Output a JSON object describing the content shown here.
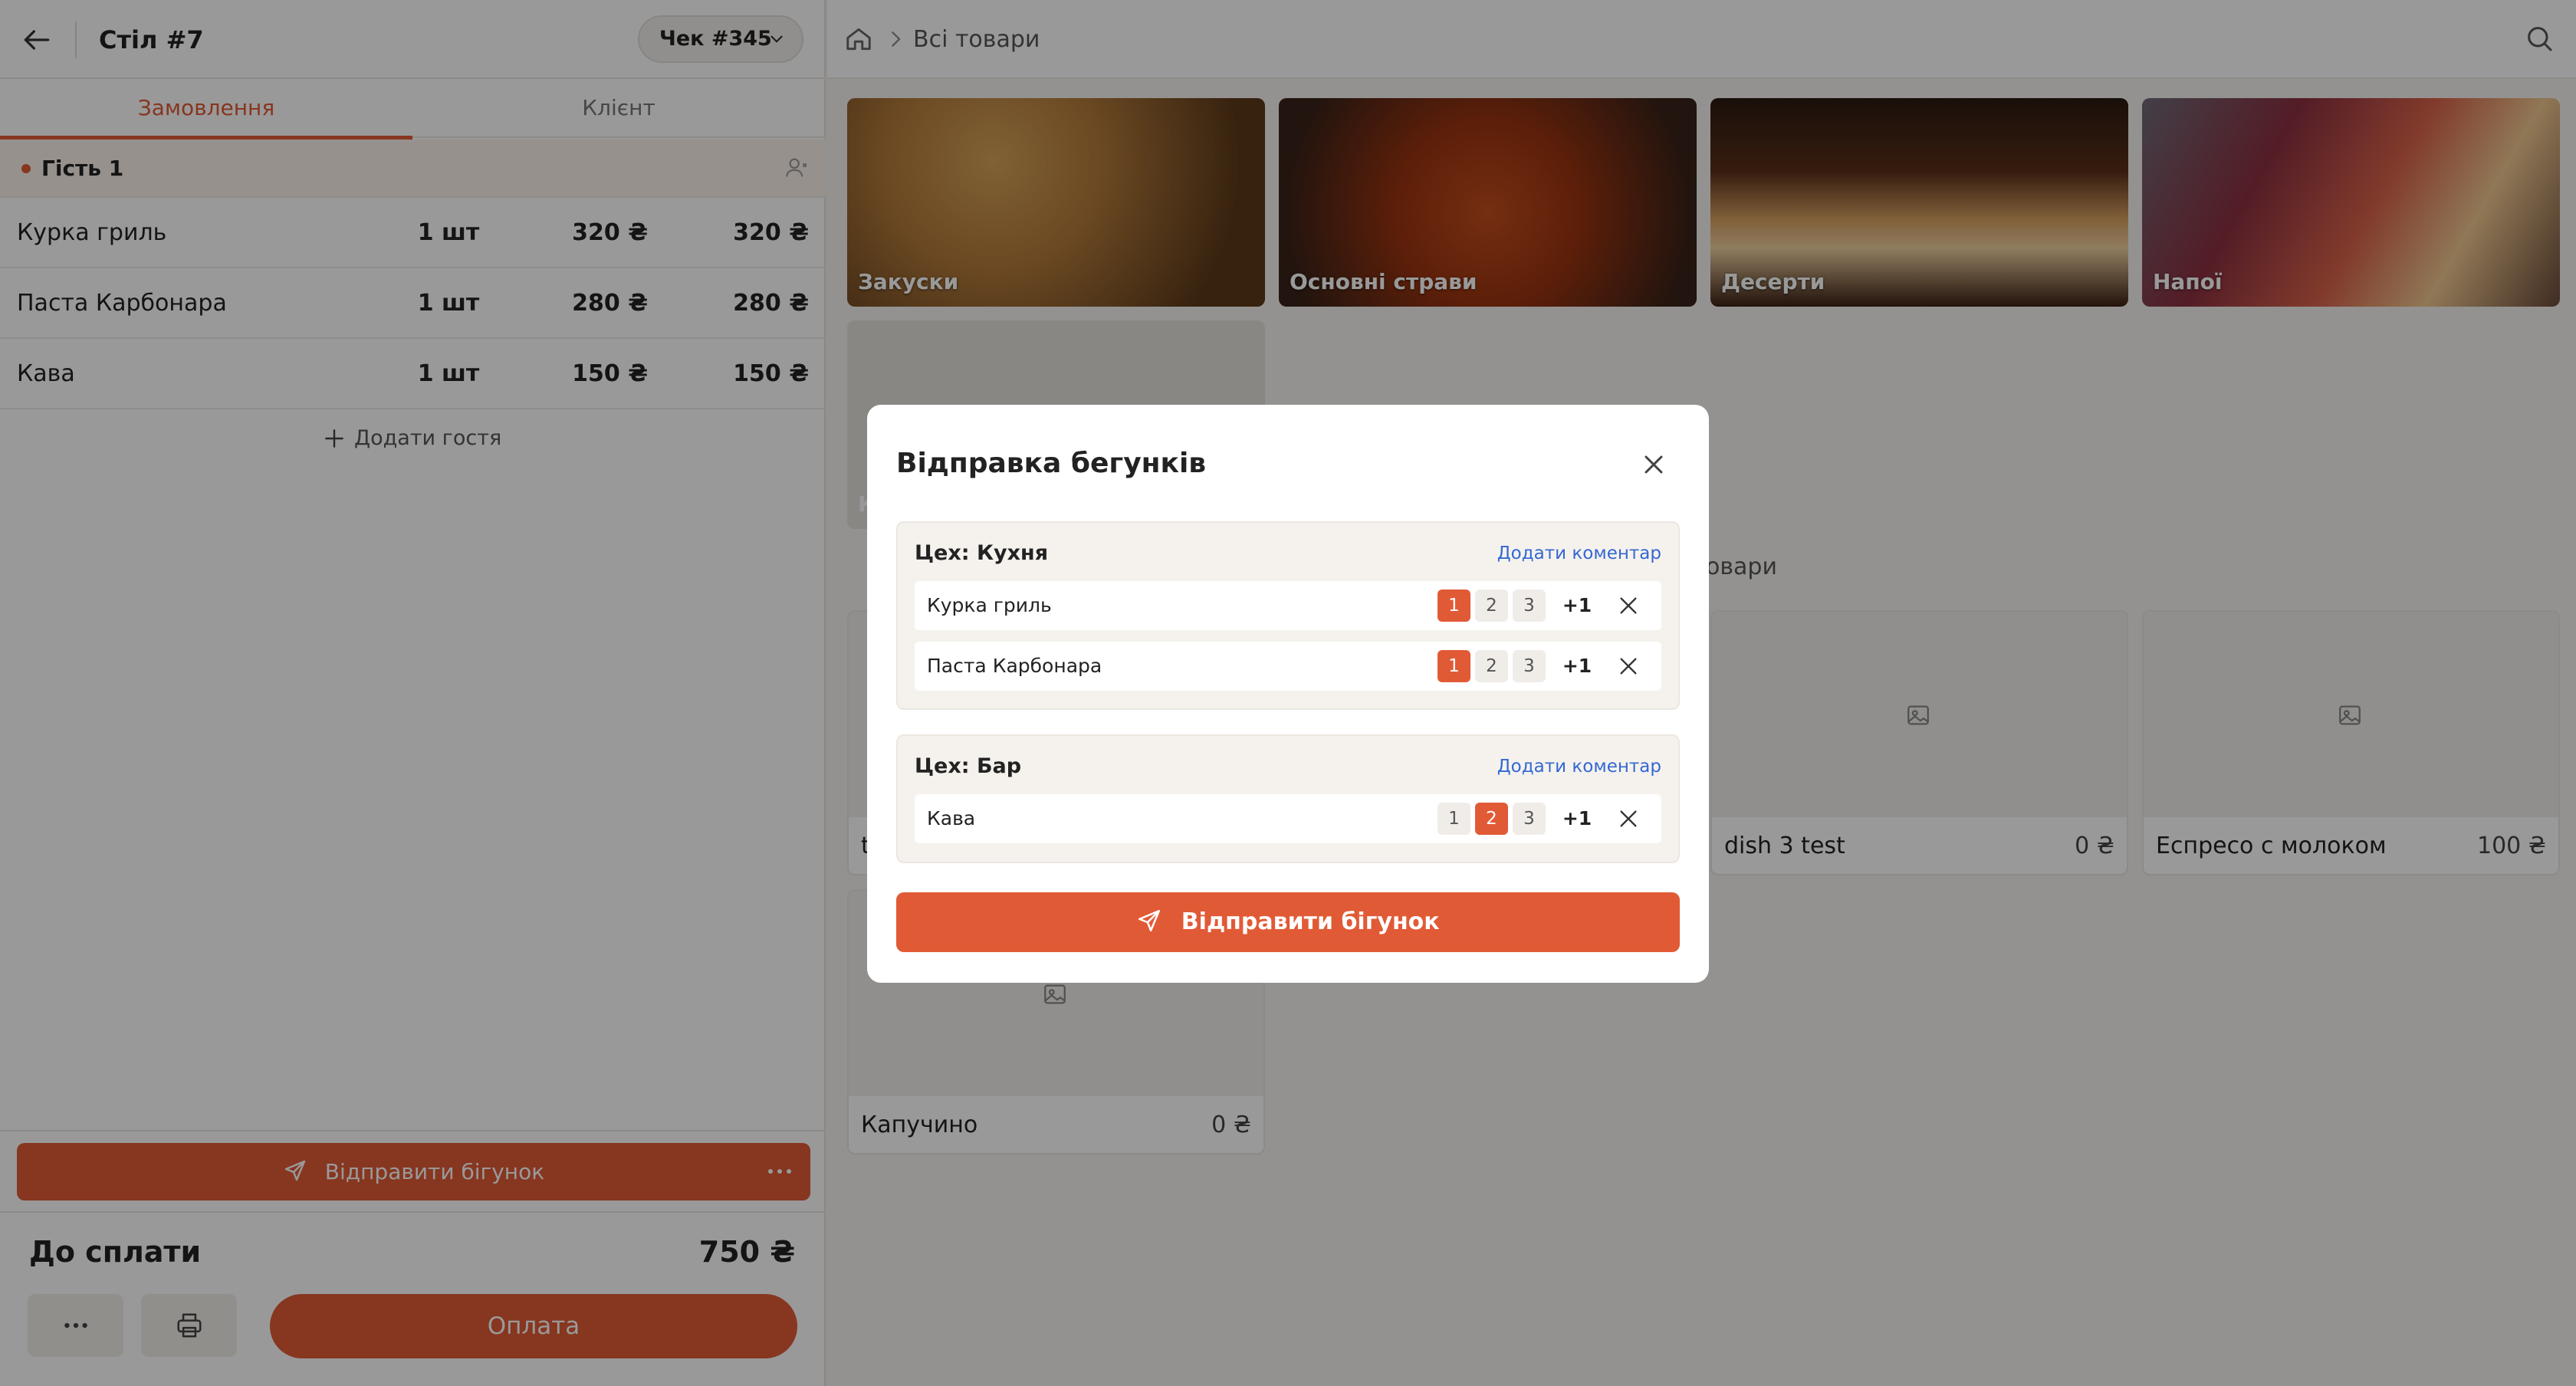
{
  "left": {
    "title": "Стіл #7",
    "check": "Чек #345",
    "tabs": [
      "Замовлення",
      "Клієнт"
    ],
    "guest": "Гість 1",
    "orders": [
      {
        "name": "Курка гриль",
        "qty": "1 шт",
        "price": "320 ₴",
        "total": "320 ₴"
      },
      {
        "name": "Паста Карбонара",
        "qty": "1 шт",
        "price": "280 ₴",
        "total": "280 ₴"
      },
      {
        "name": "Кава",
        "qty": "1 шт",
        "price": "150 ₴",
        "total": "150 ₴"
      }
    ],
    "add_guest": "Додати гостя",
    "send_label": "Відправити бігунок",
    "to_pay_label": "До сплати",
    "to_pay_value": "750 ₴",
    "pay_label": "Оплата"
  },
  "right": {
    "breadcrumb": "Всі товари",
    "categories": [
      "Закуски",
      "Основні страви",
      "Десерти",
      "Напої",
      "К"
    ],
    "section_title": "овари",
    "products": [
      {
        "name": "dish 3 test",
        "price": "0 ₴"
      },
      {
        "name": "Еспресо с молоком",
        "price": "100 ₴"
      },
      {
        "name": "Капучино",
        "price": "0 ₴"
      },
      {
        "name": "t",
        "price": ""
      }
    ]
  },
  "modal": {
    "title": "Відправка бегунків",
    "add_comment": "Додати коментар",
    "shops": [
      {
        "name": "Цех: Кухня",
        "items": [
          {
            "name": "Курка гриль",
            "selected": 1
          },
          {
            "name": "Паста Карбонара",
            "selected": 1
          }
        ]
      },
      {
        "name": "Цех: Бар",
        "items": [
          {
            "name": "Кава",
            "selected": 2
          }
        ]
      }
    ],
    "course_options": [
      "1",
      "2",
      "3"
    ],
    "plus_one": "+1",
    "send_label": "Відправити бігунок"
  },
  "colors": {
    "accent": "#e15a36",
    "link": "#3468d1"
  }
}
